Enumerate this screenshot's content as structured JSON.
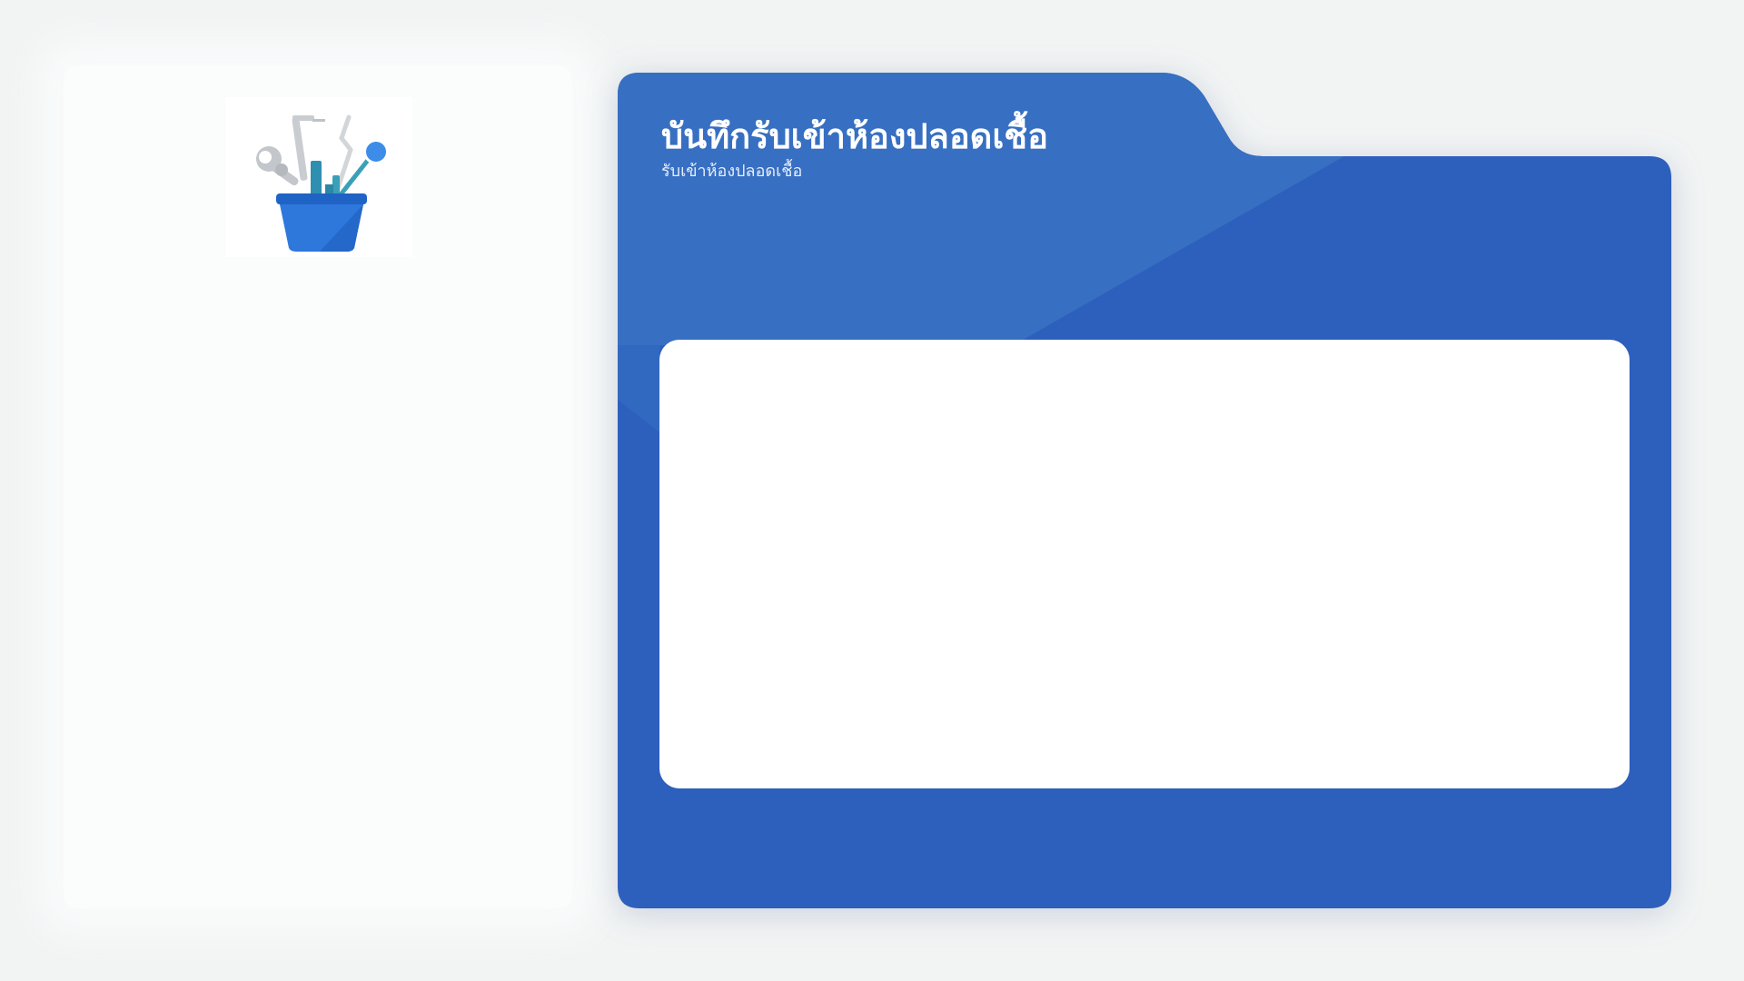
{
  "logo": {
    "icon": "dental-tools-basket-icon"
  },
  "header": {
    "title": "บันทึกรับเข้าห้องปลอดเชื้อ",
    "subtitle": "รับเข้าห้องปลอดเชื้อ"
  },
  "colors": {
    "page_background": "#f2f4f4",
    "folder_primary": "#2d5fbc",
    "folder_light": "#376fc2",
    "card_background": "#ffffff",
    "logo_accent": "#3d8ce8"
  }
}
